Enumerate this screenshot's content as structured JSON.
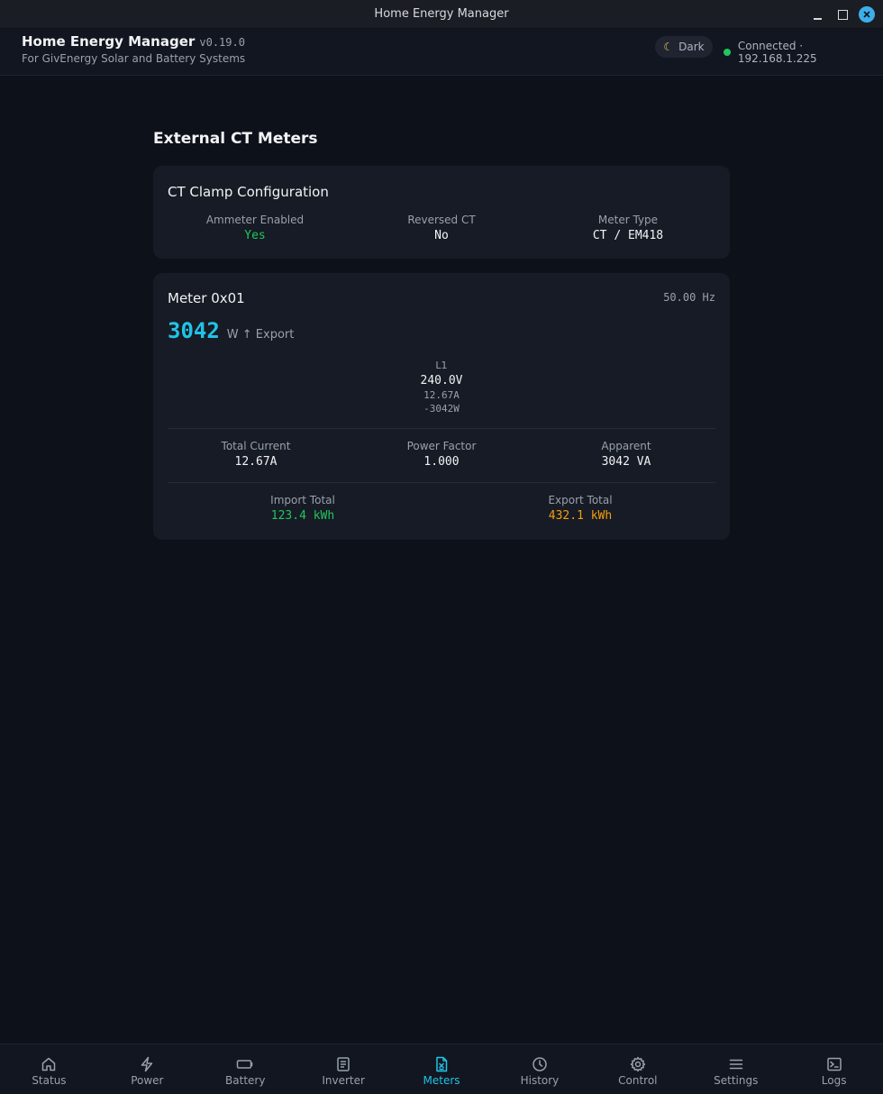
{
  "window": {
    "title": "Home Energy Manager"
  },
  "header": {
    "app_name": "Home Energy Manager",
    "version": "v0.19.0",
    "subtitle": "For GivEnergy Solar and Battery Systems",
    "theme_label": "Dark",
    "connection_text": "Connected · 192.168.1.225",
    "connection_color": "#22c55e"
  },
  "page": {
    "title": "External CT Meters"
  },
  "ct_config": {
    "title": "CT Clamp Configuration",
    "items": [
      {
        "label": "Ammeter Enabled",
        "value": "Yes"
      },
      {
        "label": "Reversed CT",
        "value": "No"
      },
      {
        "label": "Meter Type",
        "value": "CT / EM418"
      }
    ]
  },
  "meter": {
    "title": "Meter 0x01",
    "frequency": "50.00 Hz",
    "power_value": "3042",
    "power_unit": "W ↑ Export",
    "phase": {
      "label": "L1",
      "voltage": "240.0V",
      "current": "12.67A",
      "power": "-3042W"
    },
    "stats": [
      {
        "label": "Total Current",
        "value": "12.67A"
      },
      {
        "label": "Power Factor",
        "value": "1.000"
      },
      {
        "label": "Apparent",
        "value": "3042 VA"
      }
    ],
    "totals": [
      {
        "label": "Import Total",
        "value": "123.4 kWh",
        "color": "#22c55e"
      },
      {
        "label": "Export Total",
        "value": "432.1 kWh",
        "color": "#f59e0b"
      }
    ]
  },
  "nav": {
    "active_color": "#22c3e6",
    "items": [
      {
        "label": "Status",
        "icon": "home-icon"
      },
      {
        "label": "Power",
        "icon": "lightning-icon"
      },
      {
        "label": "Battery",
        "icon": "battery-icon"
      },
      {
        "label": "Inverter",
        "icon": "document-icon"
      },
      {
        "label": "Meters",
        "icon": "meter-icon",
        "active": true
      },
      {
        "label": "History",
        "icon": "clock-icon"
      },
      {
        "label": "Control",
        "icon": "gear-icon"
      },
      {
        "label": "Settings",
        "icon": "menu-icon"
      },
      {
        "label": "Logs",
        "icon": "terminal-icon"
      }
    ]
  }
}
